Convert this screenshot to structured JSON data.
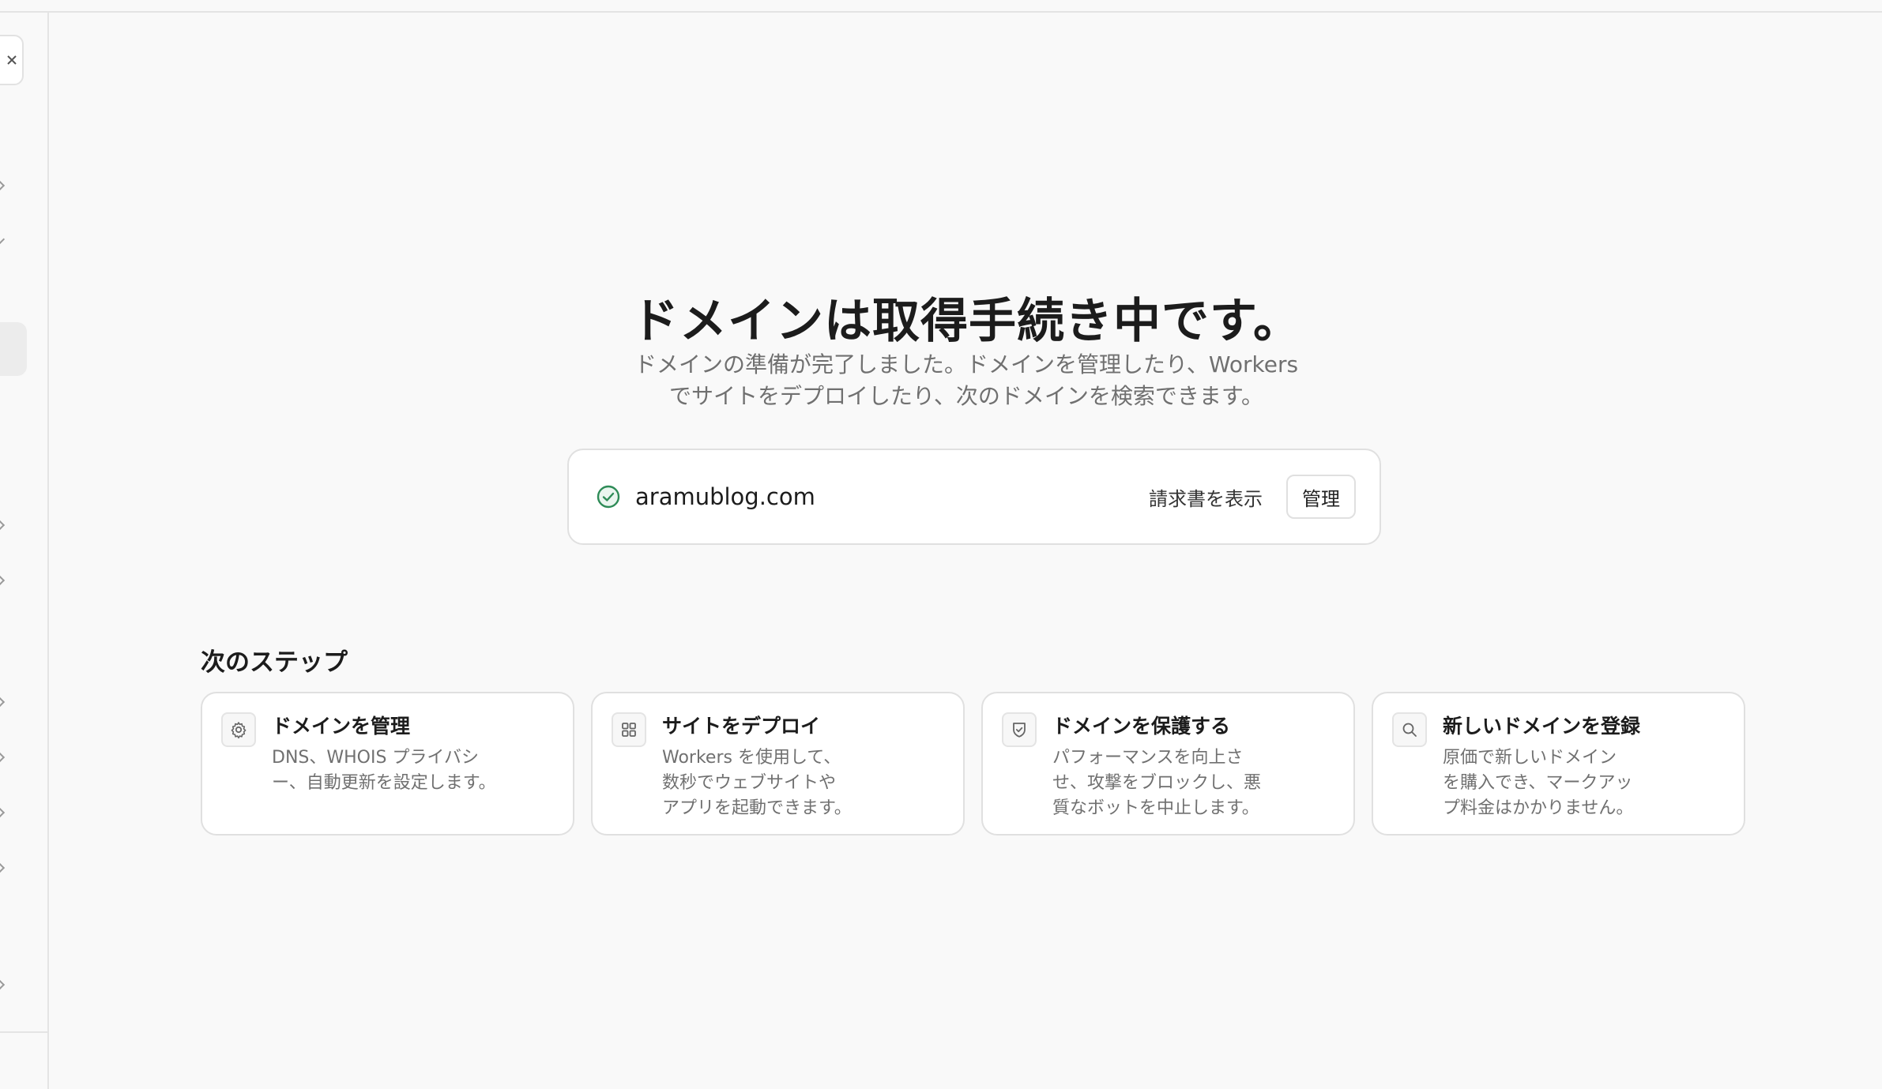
{
  "hero": {
    "title": "ドメインは取得手続き中です。",
    "subtitle": "ドメインの準備が完了しました。ドメインを管理したり、Workers\nでサイトをデプロイしたり、次のドメインを検索できます。"
  },
  "domain": {
    "name": "aramublog.com",
    "status_icon": "check-circle-icon",
    "invoice_label": "請求書を表示",
    "manage_label": "管理"
  },
  "next_steps": {
    "heading": "次のステップ",
    "items": [
      {
        "icon": "gear-icon",
        "title": "ドメインを管理",
        "desc": "DNS、WHOIS プライバシ\nー、自動更新を設定します。"
      },
      {
        "icon": "grid-icon",
        "title": "サイトをデプロイ",
        "desc": "Workers を使用して、\n数秒でウェブサイトや\nアプリを起動できます。"
      },
      {
        "icon": "shield-check-icon",
        "title": "ドメインを保護する",
        "desc": "パフォーマンスを向上さ\nせ、攻撃をブロックし、悪\n質なボットを中止します。"
      },
      {
        "icon": "search-icon",
        "title": "新しいドメインを登録",
        "desc": "原価で新しいドメイン\nを購入でき、マークアッ\nプ料金はかかりません。"
      }
    ]
  },
  "colors": {
    "accent_green": "#2e8b57",
    "background": "#f9f9f9",
    "card_border": "#e0e0e0"
  }
}
